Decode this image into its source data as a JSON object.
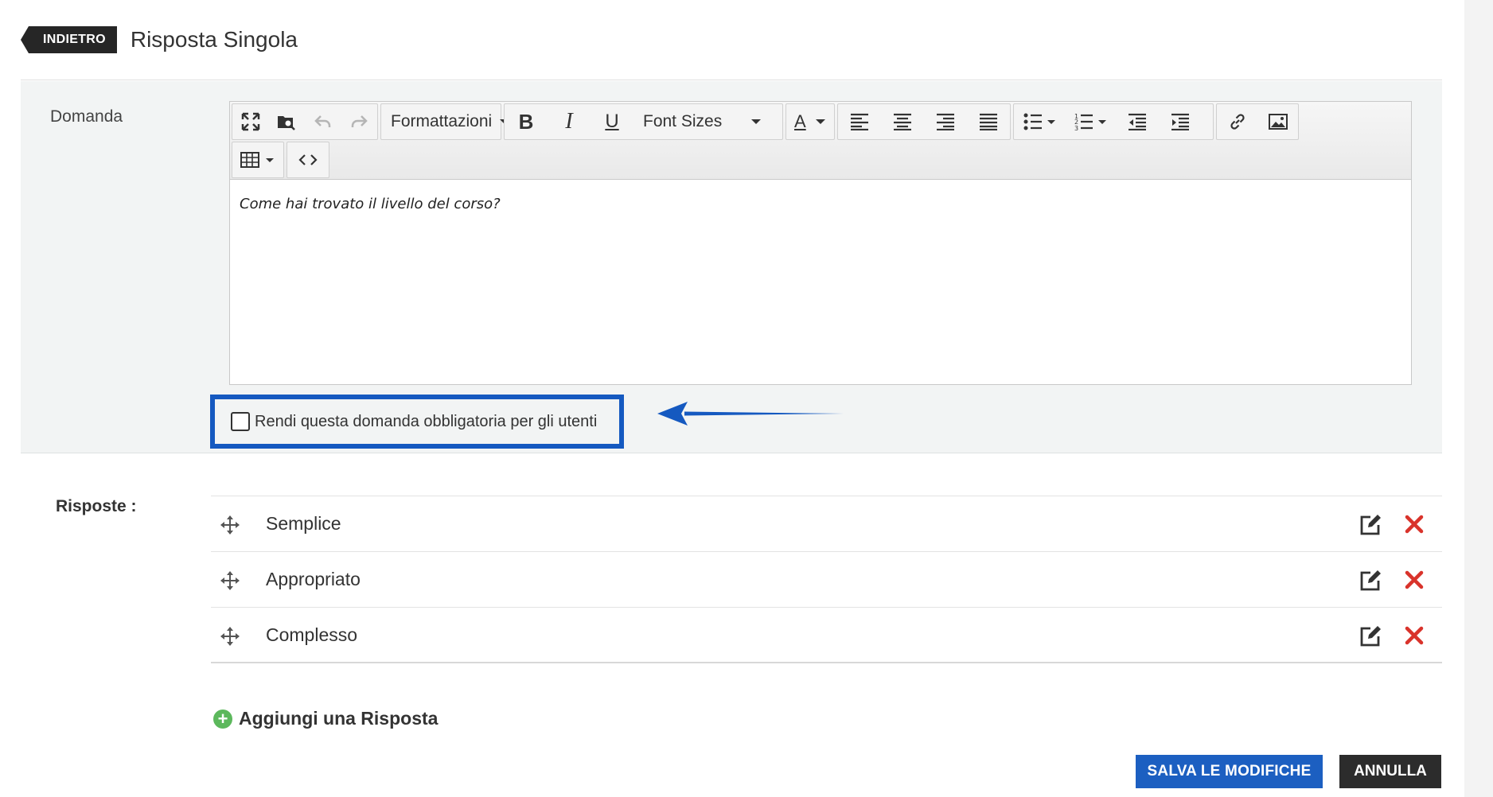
{
  "header": {
    "back_label": "INDIETRO",
    "title": "Risposta Singola"
  },
  "question": {
    "label": "Domanda",
    "toolbar": {
      "format_label": "Formattazioni",
      "font_sizes_label": "Font Sizes",
      "text_color_label": "A",
      "icons": [
        "fullscreen-icon",
        "browse-icon",
        "undo-icon",
        "redo-icon",
        "bold-icon",
        "italic-icon",
        "underline-icon",
        "text-color-icon",
        "align-left-icon",
        "align-center-icon",
        "align-right-icon",
        "align-justify-icon",
        "bullet-list-icon",
        "numbered-list-icon",
        "outdent-icon",
        "indent-icon",
        "link-icon",
        "image-icon",
        "table-icon",
        "code-icon"
      ]
    },
    "content": "Come hai trovato il livello del corso?",
    "required_label": "Rendi questa domanda obbligatoria per gli utenti",
    "required_checked": false,
    "highlight_color": "#1559c0"
  },
  "answers": {
    "label": "Risposte :",
    "items": [
      {
        "text": "Semplice"
      },
      {
        "text": "Appropriato"
      },
      {
        "text": "Complesso"
      }
    ],
    "add_label": "Aggiungi una Risposta"
  },
  "actions": {
    "save_label": "SALVA LE MODIFICHE",
    "cancel_label": "ANNULLA",
    "save_color": "#1c5fc1",
    "cancel_color": "#2c2c2c",
    "delete_color": "#d9332b",
    "add_color": "#5cb85c"
  }
}
